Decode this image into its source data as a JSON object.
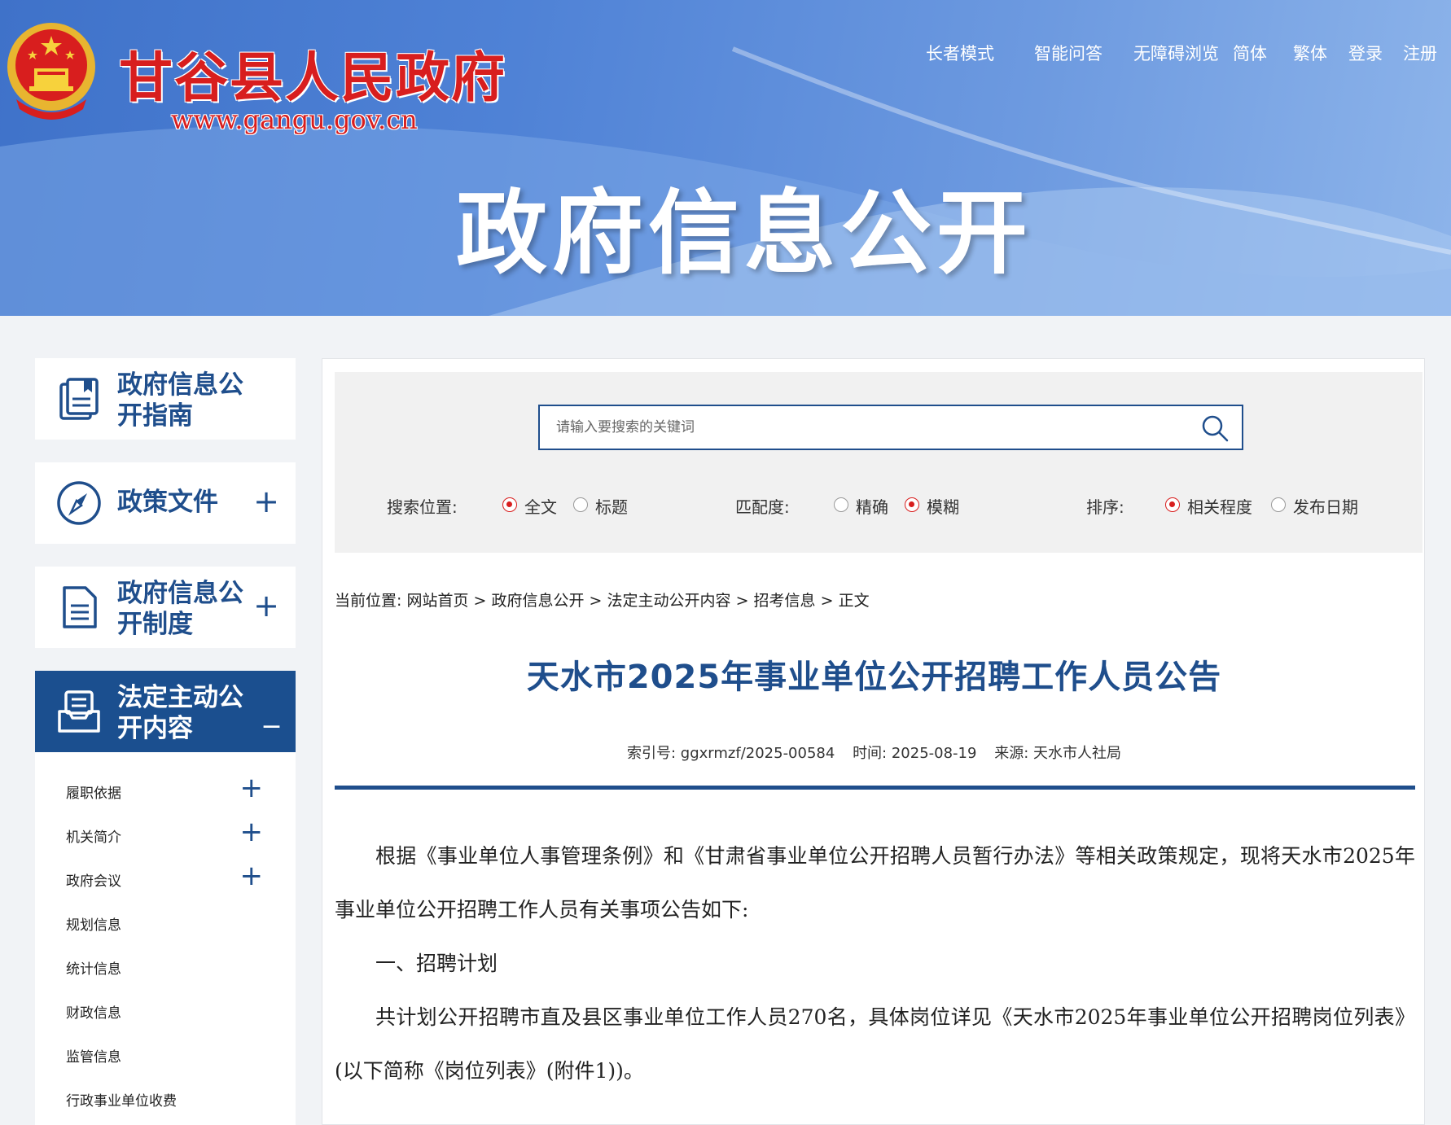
{
  "header": {
    "site_name": "甘谷县人民政府",
    "site_url": "www.gangu.gov.cn",
    "banner_title": "政府信息公开",
    "top_links": [
      "长者模式",
      "智能问答",
      "无障碍浏览",
      "简体",
      "繁体",
      "登录",
      "注册"
    ]
  },
  "sidebar": {
    "cards": [
      {
        "label": "政府信息公开指南",
        "icon": "guide-book-icon",
        "toggle": ""
      },
      {
        "label": "政策文件",
        "icon": "compass-icon",
        "toggle": "+"
      },
      {
        "label": "政府信息公开制度",
        "icon": "document-icon",
        "toggle": "+"
      },
      {
        "label": "法定主动公开内容",
        "icon": "inbox-tray-icon",
        "toggle": "_"
      }
    ],
    "sub_items": [
      {
        "label": "履职依据",
        "toggle": "+"
      },
      {
        "label": "机关简介",
        "toggle": "+"
      },
      {
        "label": "政府会议",
        "toggle": "+"
      },
      {
        "label": "规划信息",
        "toggle": ""
      },
      {
        "label": "统计信息",
        "toggle": ""
      },
      {
        "label": "财政信息",
        "toggle": ""
      },
      {
        "label": "监管信息",
        "toggle": ""
      },
      {
        "label": "行政事业单位收费",
        "toggle": ""
      }
    ]
  },
  "search": {
    "placeholder": "请输入要搜索的关键词",
    "position_label": "搜索位置:",
    "position_options": [
      "全文",
      "标题"
    ],
    "position_selected": "全文",
    "match_label": "匹配度:",
    "match_options": [
      "精确",
      "模糊"
    ],
    "match_selected": "模糊",
    "sort_label": "排序:",
    "sort_options": [
      "相关程度",
      "发布日期"
    ],
    "sort_selected": "相关程度"
  },
  "breadcrumb": {
    "prefix": "当前位置:",
    "items": [
      "网站首页",
      "政府信息公开",
      "法定主动公开内容",
      "招考信息",
      "正文"
    ],
    "separator": ">"
  },
  "article": {
    "title": "天水市2025年事业单位公开招聘工作人员公告",
    "index_no": "索引号: ggxrmzf/2025-00584",
    "time": "时间: 2025-08-19",
    "source": "来源: 天水市人社局",
    "paragraphs": [
      "根据《事业单位人事管理条例》和《甘肃省事业单位公开招聘人员暂行办法》等相关政策规定，现将天水市2025年事业单位公开招聘工作人员有关事项公告如下:",
      "一、招聘计划",
      "共计划公开招聘市直及县区事业单位工作人员270名，具体岗位详见《天水市2025年事业单位公开招聘岗位列表》(以下简称《岗位列表》(附件1))。"
    ]
  },
  "colors": {
    "brand_blue": "#1f4e8c",
    "brand_red": "#d81e1e",
    "banner_blue": "#4f82d6"
  }
}
